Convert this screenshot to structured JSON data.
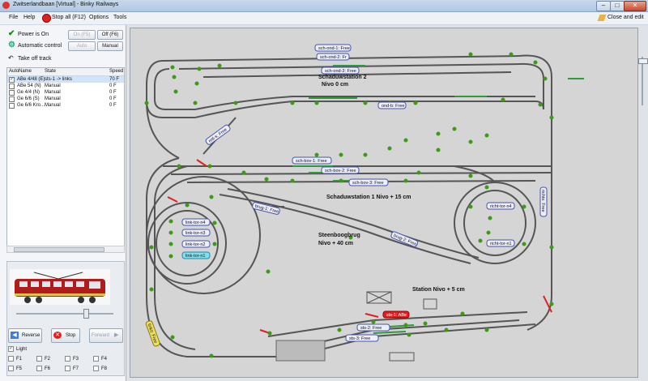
{
  "window": {
    "title": "Zwitserlandbaan [Virtual] - Binky Railways",
    "min": "–",
    "max": "□",
    "close": "✕"
  },
  "menu": {
    "file": "File",
    "help": "Help",
    "stop_all": "Stop all (F12)",
    "options": "Options",
    "tools": "Tools",
    "close_edit": "Close and edit"
  },
  "power": {
    "label": "Power is On",
    "on": "On (F5)",
    "off": "Off (F6)"
  },
  "auto": {
    "label": "Automatic control",
    "auto": "Auto",
    "manual": "Manual"
  },
  "take_off": "Take off track",
  "locs": {
    "headers": [
      "Auto",
      "Name",
      "State",
      "Speed"
    ],
    "rows": [
      {
        "name": "ABe 4/48 (E)",
        "state": "sts-1 -> links",
        "speed": "70 F",
        "checked": true
      },
      {
        "name": "ABe 54 (N)",
        "state": "Manual",
        "speed": "0 F",
        "checked": false
      },
      {
        "name": "Ge 4/4 (N)",
        "state": "Manual",
        "speed": "0 F",
        "checked": false
      },
      {
        "name": "Ge 6/6 (S)",
        "state": "Manual",
        "speed": "0 F",
        "checked": false
      },
      {
        "name": "Ge 6/6 Kro...",
        "state": "Manual",
        "speed": "0 F",
        "checked": false
      }
    ]
  },
  "drive": {
    "reverse": "Reverse",
    "stop": "Stop",
    "forward": "Forward",
    "speed": 0.7
  },
  "functions": {
    "light": "Light",
    "f": [
      "F1",
      "F2",
      "F3",
      "F4",
      "F5",
      "F6",
      "F7",
      "F8"
    ]
  },
  "board": {
    "blocks": {
      "ch_ond_1": "sch-ond-1: Free",
      "ch_ond_2": "sch-ond-2: Fr",
      "ch_ond_3": "sch-ond-3: Free",
      "ond_b": "ond-b: Free",
      "ret_l": "retl-s: Free",
      "ch_bov_1": "sch-bov-1: Free",
      "ch_bov_2": "sch-bov-2: Free",
      "ch_bov_3": "sch-bov-3: Free",
      "brug_1": "brug-1: Free",
      "brug_2": "brug-2: Free",
      "richt_r": "richts: Free",
      "richt_tor_n4": "richt-tor-n4",
      "richt_tor_n1": "richt-tor-n1",
      "link_tor_n4": "link-tor-n4",
      "link_tor_n3": "link-tor-n3",
      "link_tor_n2": "link-tor-n2",
      "link_tor_n1": "link-tor-n1",
      "sts_1": "sts-1: ABe",
      "sts_2": "sts-2: Free",
      "sts_3": "sts-3: Free",
      "links_l": "links: Free"
    },
    "labels": {
      "shadow2": "Schaduwstation 2",
      "nivo0": "Nivo 0 cm",
      "shadow1": "Schaduwstation 1 Nivo + 15 cm",
      "bridge": "Steenboogbrug",
      "bridge_nivo": "Nivo + 40 cm",
      "station": "Station Nivo + 5 cm"
    }
  }
}
